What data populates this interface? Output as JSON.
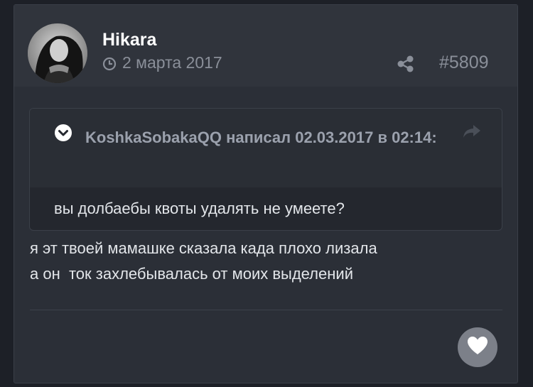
{
  "post": {
    "author": "Hikara",
    "date": "2 марта 2017",
    "post_number": "#5809",
    "quote": {
      "header": "KoshkaSobakaQQ написал 02.03.2017 в 02:14:",
      "text": "вы долбаебы квоты удалять не умеете?"
    },
    "message": "я эт твоей мамашке сказала када плохо лизала\nа он  ток захлебывалась от моих выделений"
  },
  "icons": {
    "clock": "clock-icon",
    "share": "share-icon",
    "expand": "chevron-down-circle-icon",
    "reply": "reply-arrow-icon",
    "like": "heart-icon"
  },
  "colors": {
    "page_bg": "#1d2027",
    "card_bg": "#2b2f37",
    "header_bg": "#30343c",
    "quote_bg": "#24272e",
    "muted_text": "#8a8f99",
    "like_button": "#7c8089"
  }
}
